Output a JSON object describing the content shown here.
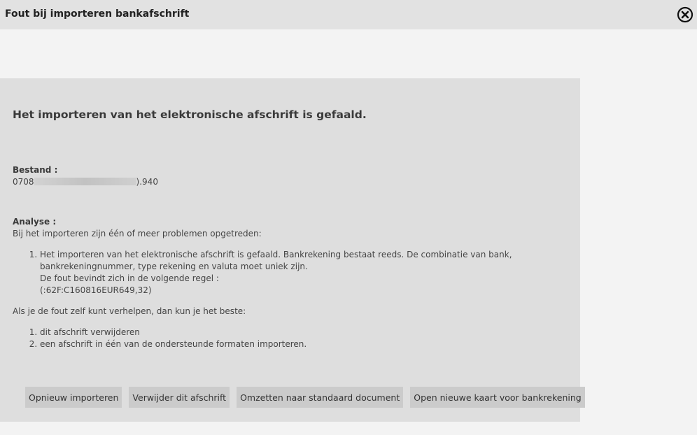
{
  "window": {
    "title": "Fout bij importeren bankafschrift",
    "close_icon": "close-circle-icon"
  },
  "panel": {
    "heading": "Het importeren van het elektronische afschrift is gefaald.",
    "file_label": "Bestand :",
    "file_prefix": "0708",
    "file_suffix": ").940",
    "analysis_label": "Analyse :",
    "analysis_intro": "Bij het importeren zijn één of meer problemen opgetreden:",
    "problems": [
      {
        "line1": "Het importeren van het elektronische afschrift is gefaald. Bankrekening bestaat reeds. De combinatie van bank,",
        "line2": "bankrekeningnummer, type rekening en valuta moet uniek zijn.",
        "line3": "De fout bevindt zich in de volgende regel :",
        "line4": "(:62F:C160816EUR649,32)"
      }
    ],
    "fix_intro": "Als je de fout zelf kunt verhelpen, dan kun je het beste:",
    "fix_steps": [
      "dit afschrift verwijderen",
      "een afschrift in één van de ondersteunde formaten importeren."
    ]
  },
  "buttons": {
    "reimport": "Opnieuw importeren",
    "delete": "Verwijder dit afschrift",
    "convert": "Omzetten naar standaard document",
    "open_card": "Open nieuwe kaart voor bankrekening"
  }
}
